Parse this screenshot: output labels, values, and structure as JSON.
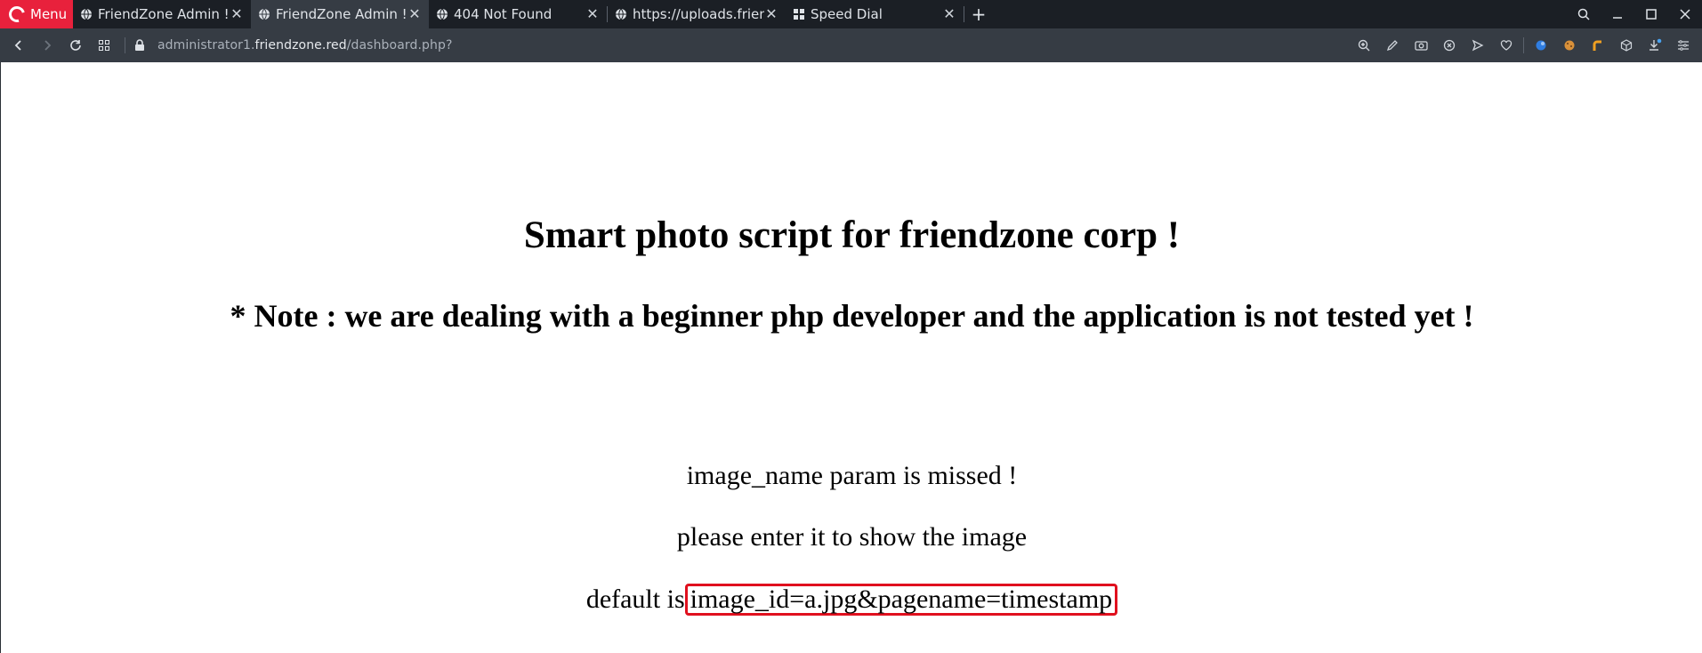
{
  "browser": {
    "menu_label": "Menu",
    "tabs": [
      {
        "title": "FriendZone Admin !",
        "favicon": "globe-icon",
        "active": false
      },
      {
        "title": "FriendZone Admin !",
        "favicon": "globe-icon",
        "active": true
      },
      {
        "title": "404 Not Found",
        "favicon": "globe-icon",
        "active": false
      },
      {
        "title": "https://uploads.frienc",
        "favicon": "globe-icon",
        "active": false
      },
      {
        "title": "Speed Dial",
        "favicon": "speed-dial-icon",
        "active": false
      }
    ],
    "new_tab_label": "+",
    "address": {
      "prefix": "administrator1.",
      "host": "friendzone.red",
      "path": "/dashboard.php?"
    },
    "accent_color": "#e8213c"
  },
  "page": {
    "heading": "Smart photo script for friendzone corp !",
    "note": "* Note : we are dealing with a beginner php developer and the application is not tested yet !",
    "line1": "image_name param is missed !",
    "line2": "please enter it to show the image",
    "line3_prefix": "default is",
    "line3_highlight": " image_id=a.jpg&pagename=timestamp",
    "highlight_color": "#e0101e"
  }
}
